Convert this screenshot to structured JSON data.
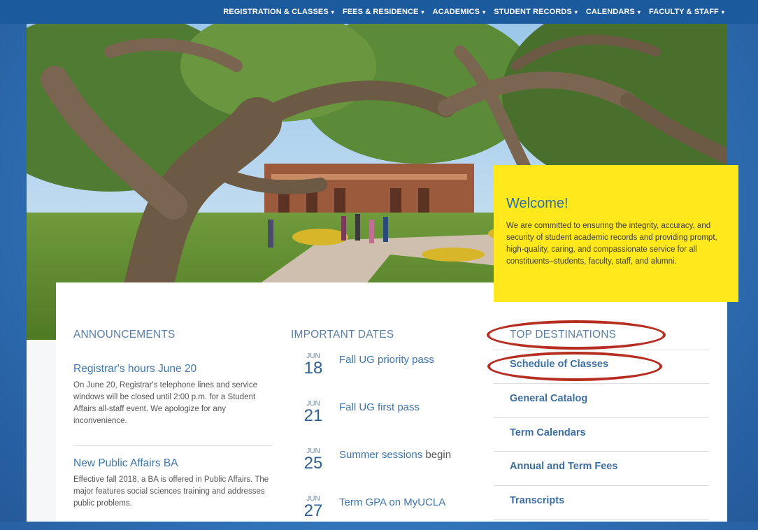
{
  "nav": {
    "items": [
      {
        "label": "REGISTRATION & CLASSES"
      },
      {
        "label": "FEES & RESIDENCE"
      },
      {
        "label": "ACADEMICS"
      },
      {
        "label": "STUDENT RECORDS"
      },
      {
        "label": "CALENDARS"
      },
      {
        "label": "FACULTY & STAFF"
      }
    ],
    "caret": "▾"
  },
  "welcome": {
    "title": "Welcome!",
    "body": "We are committed to ensuring the integrity, accuracy, and security of student academic records and providing prompt, high-quality, caring, and compassionate service for all constituents–students, faculty, staff, and alumni."
  },
  "announcements": {
    "heading": "ANNOUNCEMENTS",
    "items": [
      {
        "title": "Registrar's hours June 20",
        "body": "On June 20, Registrar's telephone lines and service windows will be closed until 2:00 p.m. for a Student Affairs all-staff event. We apologize for any inconvenience."
      },
      {
        "title": "New Public Affairs BA",
        "body": "Effective fall 2018, a BA is offered in Public Affairs. The major features social sciences training and addresses public problems."
      }
    ]
  },
  "dates": {
    "heading": "IMPORTANT DATES",
    "items": [
      {
        "month": "JUN",
        "day": "18",
        "label": "Fall UG priority pass",
        "suffix": ""
      },
      {
        "month": "JUN",
        "day": "21",
        "label": "Fall UG first pass",
        "suffix": ""
      },
      {
        "month": "JUN",
        "day": "25",
        "label": "Summer sessions",
        "suffix": " begin"
      },
      {
        "month": "JUN",
        "day": "27",
        "label": "Term GPA on MyUCLA",
        "suffix": ""
      }
    ]
  },
  "destinations": {
    "heading": "TOP DESTINATIONS",
    "items": [
      {
        "label": "Schedule of Classes"
      },
      {
        "label": "General Catalog"
      },
      {
        "label": "Term Calendars"
      },
      {
        "label": "Annual and Term Fees"
      },
      {
        "label": "Transcripts"
      }
    ]
  },
  "colors": {
    "nav_bg": "#1c5a9e",
    "welcome_bg": "#ffe91d",
    "link": "#3e75ad",
    "highlight_ellipse": "#b62d22"
  }
}
